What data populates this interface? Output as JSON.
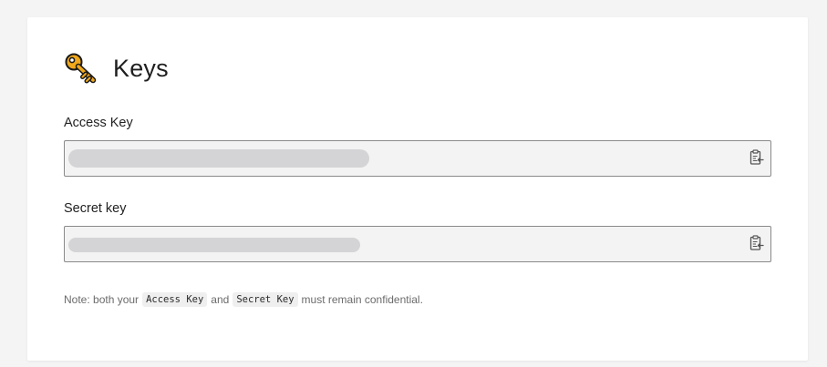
{
  "header": {
    "title": "Keys",
    "icon": "key-icon",
    "icon_color": "#e8a317"
  },
  "fields": [
    {
      "label": "Access Key",
      "value": "",
      "copy_icon": "clipboard-copy-icon"
    },
    {
      "label": "Secret key",
      "value": "",
      "copy_icon": "clipboard-copy-icon"
    }
  ],
  "note": {
    "prefix": "Note: both your",
    "code1": "Access Key",
    "middle": "and",
    "code2": "Secret Key",
    "suffix": "must remain confidential."
  },
  "colors": {
    "background": "#f4f4f4",
    "card": "#ffffff",
    "field_bg": "#f3f3f3",
    "redaction": "#d4d4d6"
  }
}
